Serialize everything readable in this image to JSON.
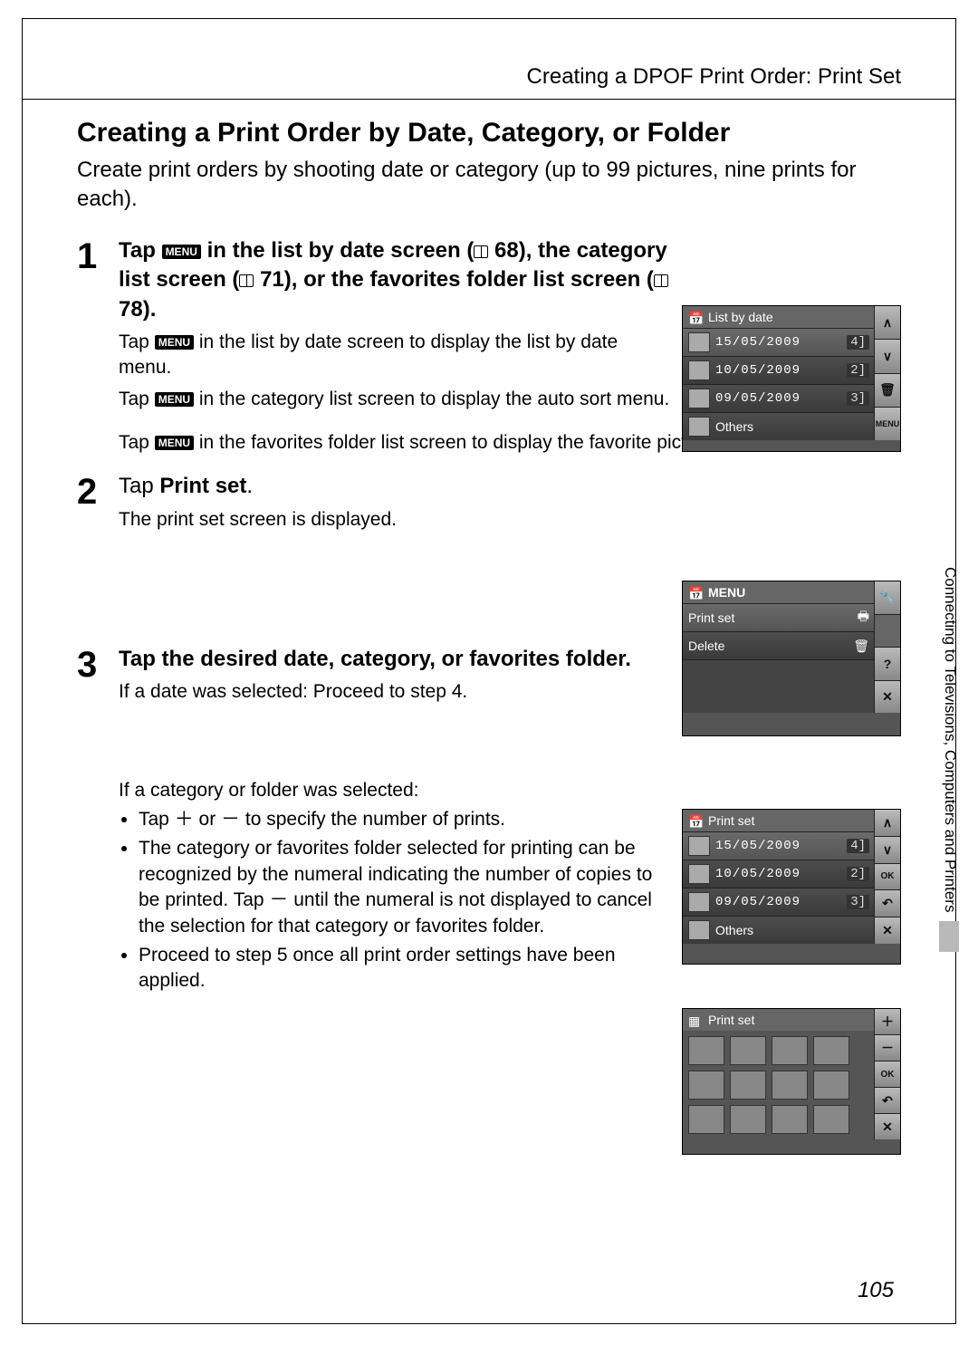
{
  "header": "Creating a DPOF Print Order: Print Set",
  "title": "Creating a Print Order by Date, Category, or Folder",
  "intro": "Create print orders by shooting date or category (up to 99 pictures, nine prints for each).",
  "side_tab": "Connecting to Televisions, Computers and Printers",
  "page_number": "105",
  "menu_badge": "MENU",
  "steps": {
    "s1": {
      "num": "1",
      "title_pre": "Tap ",
      "title_mid1": " in the list by date screen (",
      "ref1": "68",
      "title_mid2": "), the category list screen (",
      "ref2": "71",
      "title_mid3": "), or the favorites folder list screen (",
      "ref3": "78",
      "title_end": ").",
      "desc1_pre": "Tap ",
      "desc1_post": " in the list by date screen to display the list by date menu.",
      "desc2_pre": "Tap ",
      "desc2_post": " in the category list screen to display the auto sort menu.",
      "desc3_pre": "Tap ",
      "desc3_post": " in the favorites folder list screen to display the favorite pictures menu."
    },
    "s2": {
      "num": "2",
      "title_pre": "Tap ",
      "title_bold": "Print set",
      "title_end": ".",
      "desc": "The print set screen is displayed."
    },
    "s3": {
      "num": "3",
      "title": "Tap the desired date, category, or favorites folder.",
      "desc1": "If a date was selected: Proceed to step 4.",
      "desc2": "If a category or folder was selected:",
      "b1": "Tap ＋ or － to specify the number of prints.",
      "b2": "The category or favorites folder selected for printing can be recognized by the numeral indicating the number of copies to be printed. Tap － until the numeral is not displayed to cancel the selection for that category or favorites folder.",
      "b3": "Proceed to step 5 once all print order settings have been applied."
    }
  },
  "screens": {
    "cam1": {
      "title": "List by date",
      "rows": [
        {
          "date": "15/05/2009",
          "count": "4"
        },
        {
          "date": "10/05/2009",
          "count": "2"
        },
        {
          "date": "09/05/2009",
          "count": "3"
        }
      ],
      "others": "Others",
      "side": [
        "up",
        "down",
        "trash",
        "menu"
      ],
      "side_labels": {
        "menu": "MENU"
      }
    },
    "cam2": {
      "title": "MENU",
      "rows": [
        {
          "label": "Print set"
        },
        {
          "label": "Delete"
        }
      ],
      "side": [
        "wrench",
        "blank",
        "help",
        "close"
      ]
    },
    "cam3": {
      "title": "Print set",
      "rows": [
        {
          "date": "15/05/2009",
          "count": "4"
        },
        {
          "date": "10/05/2009",
          "count": "2"
        },
        {
          "date": "09/05/2009",
          "count": "3"
        }
      ],
      "others": "Others",
      "side": [
        "up",
        "down",
        "ok",
        "back",
        "close"
      ],
      "side_labels": {
        "ok": "OK"
      }
    },
    "cam4": {
      "title": "Print set",
      "side": [
        "plus",
        "minus",
        "ok",
        "back",
        "close"
      ],
      "side_labels": {
        "ok": "OK"
      }
    }
  }
}
